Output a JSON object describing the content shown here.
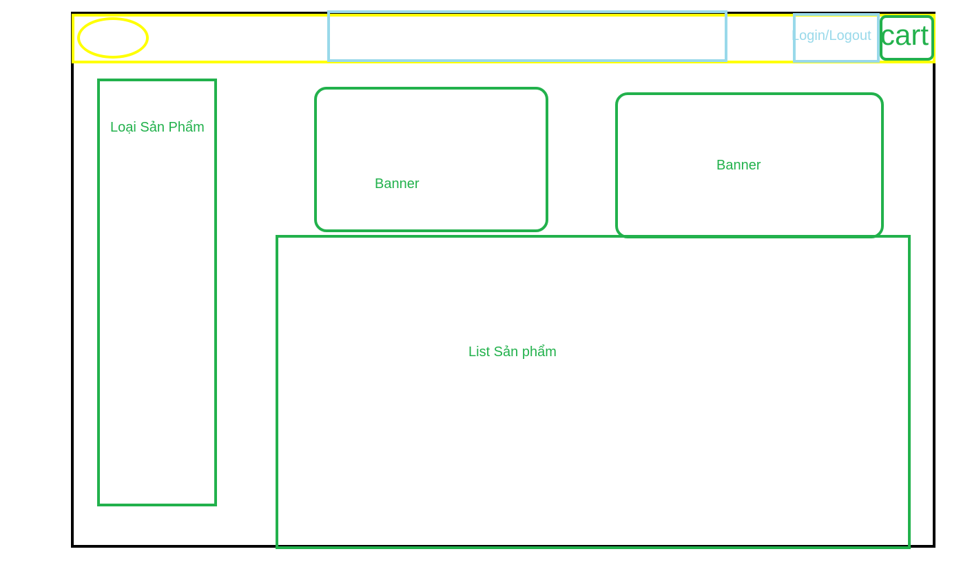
{
  "header": {
    "login_label": "Login/Logout",
    "cart_label": "cart"
  },
  "sidebar": {
    "label": "Loại Sản Phẩm"
  },
  "banners": [
    {
      "label": "Banner"
    },
    {
      "label": "Banner"
    }
  ],
  "product_list": {
    "label": "List Sản phẩm"
  },
  "colors": {
    "frame": "#000000",
    "header": "#ffff00",
    "input": "#99d9ea",
    "section": "#22b14c"
  }
}
